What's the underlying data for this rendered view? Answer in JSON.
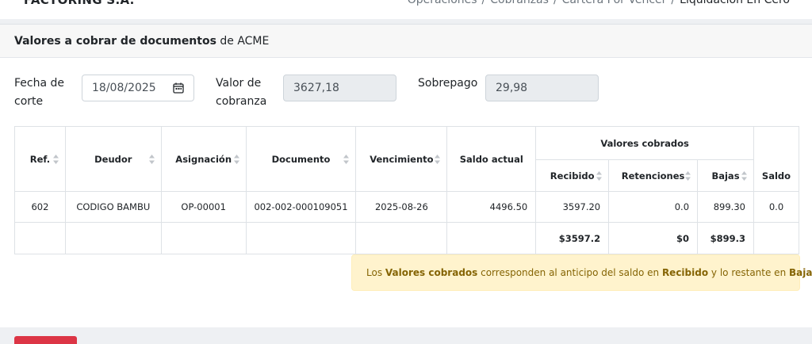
{
  "header": {
    "brand": "FACTORING S.A.",
    "breadcrumb": [
      "Operaciones",
      "Cobranzas",
      "Cartera Por Vencer",
      "Liquidación En Cero"
    ]
  },
  "card": {
    "title_bold": "Valores a cobrar de documentos",
    "title_rest": " de ACME"
  },
  "form": {
    "fecha_label_1": "Fecha de",
    "fecha_label_2": "corte",
    "fecha_value": "18/08/2025",
    "valor_label_1": "Valor de",
    "valor_label_2": "cobranza",
    "valor_value": "3627,18",
    "sobrepago_label": "Sobrepago",
    "sobrepago_value": "29,98"
  },
  "table": {
    "group_header": "Valores cobrados",
    "headers": {
      "ref": "Ref.",
      "deudor": "Deudor",
      "asignacion": "Asignación",
      "documento": "Documento",
      "vencimiento": "Vencimiento",
      "saldo_actual": "Saldo actual",
      "recibido": "Recibido",
      "retenciones": "Retenciones",
      "bajas": "Bajas",
      "saldo": "Saldo"
    },
    "row": {
      "ref": "602",
      "deudor": "CODIGO BAMBU",
      "asignacion": "OP-00001",
      "documento": "002-002-000109051",
      "vencimiento": "2025-08-26",
      "saldo_actual": "4496.50",
      "recibido": "3597.20",
      "retenciones": "0.0",
      "bajas": "899.30",
      "saldo": "0.0"
    },
    "totals": {
      "recibido": "$3597.2",
      "retenciones": "$0",
      "bajas": "$899.3"
    }
  },
  "alert": {
    "t1": "Los ",
    "b1": "Valores cobrados",
    "t2": " corresponden al anticipo del saldo en ",
    "b2": "Recibido",
    "t3": " y lo restante en ",
    "b3": "Bajas"
  },
  "colors": {
    "alert_bg": "#fff3cd",
    "alert_text": "#856404",
    "danger": "#dc3545"
  }
}
